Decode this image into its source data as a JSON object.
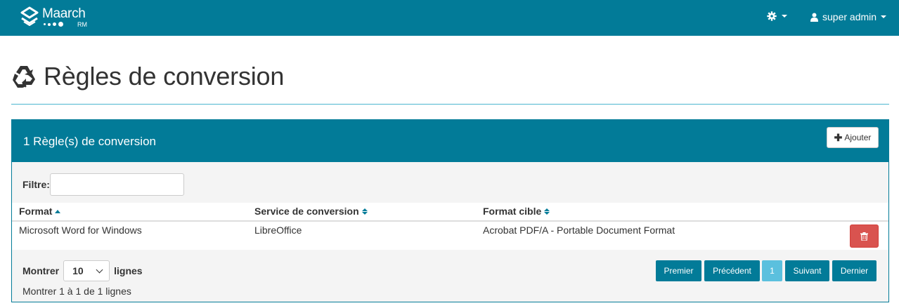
{
  "navbar": {
    "brand_name": "Maarch",
    "brand_sub": "RM",
    "settings_icon": "cog-icon",
    "user_icon": "user-icon",
    "user_label": "super admin"
  },
  "page": {
    "title_icon": "recycle-icon",
    "title": "Règles de conversion"
  },
  "panel": {
    "title": "1 Règle(s) de conversion",
    "add_button_label": "Ajouter",
    "filter_label": "Filtre:",
    "filter_value": ""
  },
  "table": {
    "columns": [
      {
        "label": "Format",
        "sort": "ascending"
      },
      {
        "label": "Service de conversion",
        "sort": "none"
      },
      {
        "label": "Format cible",
        "sort": "none"
      }
    ],
    "rows": [
      [
        "Microsoft Word for Windows",
        "LibreOffice",
        "Acrobat PDF/A - Portable Document Format"
      ]
    ]
  },
  "footer": {
    "show_label": "Montrer",
    "page_size": "10",
    "rows_label": "lignes",
    "info": "Montrer 1 à 1 de 1 lignes",
    "pagination": {
      "first": "Premier",
      "previous": "Précédent",
      "current": "1",
      "next": "Suivant",
      "last": "Dernier"
    }
  },
  "colors": {
    "primary": "#027b98",
    "danger": "#d9534f",
    "active_page": "#5bc0de"
  }
}
